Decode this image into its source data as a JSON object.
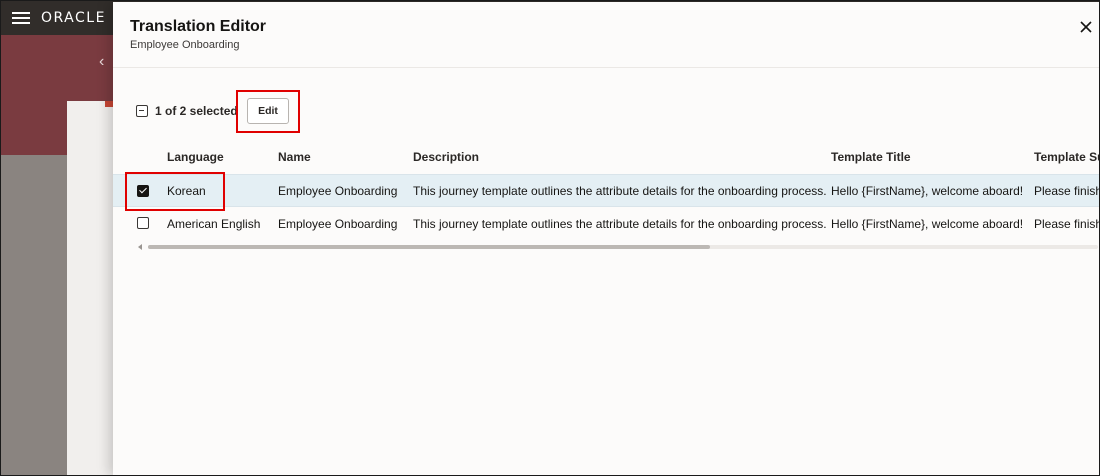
{
  "background": {
    "brand": "ORACLE"
  },
  "drawer": {
    "title": "Translation Editor",
    "subtitle": "Employee Onboarding",
    "close_label": "×"
  },
  "toolbar": {
    "selection_text": "1 of 2 selected",
    "edit_label": "Edit"
  },
  "table": {
    "columns": [
      "Language",
      "Name",
      "Description",
      "Template Title",
      "Template Subject"
    ],
    "rows": [
      {
        "selected": true,
        "language": "Korean",
        "name": "Employee Onboarding",
        "description": "This journey template outlines the attribute details for the onboarding process.",
        "template_title": "Hello {FirstName}, welcome aboard!",
        "template_subject": "Please finish"
      },
      {
        "selected": false,
        "language": "American English",
        "name": "Employee Onboarding",
        "description": "This journey template outlines the attribute details for the onboarding process.",
        "template_title": "Hello {FirstName}, welcome aboard!",
        "template_subject": "Please finish"
      }
    ]
  },
  "colors": {
    "topbar": "#312d2a",
    "hero": "#7a3b40",
    "selected_row": "#e4eff4",
    "highlight": "#e00000"
  }
}
